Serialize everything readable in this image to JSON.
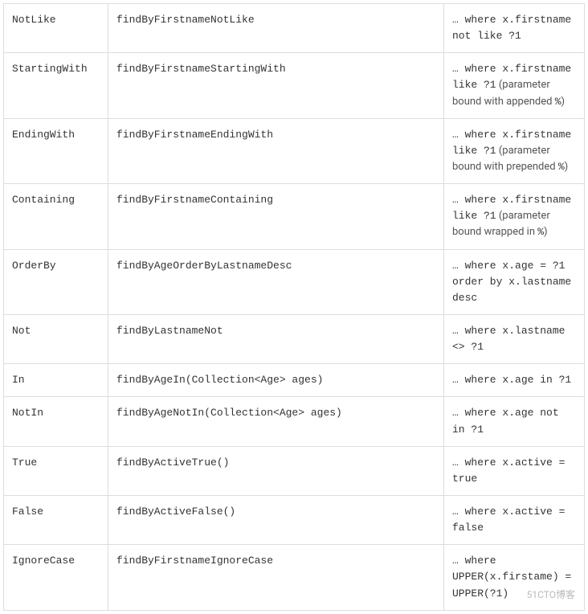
{
  "watermark": "51CTO博客",
  "table": {
    "rows": [
      {
        "keyword": "NotLike",
        "sample": "findByFirstnameNotLike",
        "result": [
          {
            "type": "code",
            "text": "… where x.firstname not like ?1"
          }
        ]
      },
      {
        "keyword": "StartingWith",
        "sample": "findByFirstnameStartingWith",
        "result": [
          {
            "type": "code",
            "text": "… where x.firstname like ?1"
          },
          {
            "type": "plain",
            "text": " (parameter bound with appended "
          },
          {
            "type": "code",
            "text": "%"
          },
          {
            "type": "plain",
            "text": ")"
          }
        ]
      },
      {
        "keyword": "EndingWith",
        "sample": "findByFirstnameEndingWith",
        "result": [
          {
            "type": "code",
            "text": "… where x.firstname like ?1"
          },
          {
            "type": "plain",
            "text": " (parameter bound with prepended "
          },
          {
            "type": "code",
            "text": "%"
          },
          {
            "type": "plain",
            "text": ")"
          }
        ]
      },
      {
        "keyword": "Containing",
        "sample": "findByFirstnameContaining",
        "result": [
          {
            "type": "code",
            "text": "… where x.firstname like ?1"
          },
          {
            "type": "plain",
            "text": " (parameter bound wrapped in "
          },
          {
            "type": "code",
            "text": "%"
          },
          {
            "type": "plain",
            "text": ")"
          }
        ]
      },
      {
        "keyword": "OrderBy",
        "sample": "findByAgeOrderByLastnameDesc",
        "result": [
          {
            "type": "code",
            "text": "… where x.age = ?1 order by x.lastname desc"
          }
        ]
      },
      {
        "keyword": "Not",
        "sample": "findByLastnameNot",
        "result": [
          {
            "type": "code",
            "text": "… where x.lastname <> ?1"
          }
        ]
      },
      {
        "keyword": "In",
        "sample": "findByAgeIn(Collection<Age> ages)",
        "result": [
          {
            "type": "code",
            "text": "… where x.age in ?1"
          }
        ]
      },
      {
        "keyword": "NotIn",
        "sample": "findByAgeNotIn(Collection<Age> ages)",
        "result": [
          {
            "type": "code",
            "text": "… where x.age not in ?1"
          }
        ]
      },
      {
        "keyword": "True",
        "sample": "findByActiveTrue()",
        "result": [
          {
            "type": "code",
            "text": "… where x.active = true"
          }
        ]
      },
      {
        "keyword": "False",
        "sample": "findByActiveFalse()",
        "result": [
          {
            "type": "code",
            "text": "… where x.active = false"
          }
        ]
      },
      {
        "keyword": "IgnoreCase",
        "sample": "findByFirstnameIgnoreCase",
        "result": [
          {
            "type": "code",
            "text": "… where UPPER(x.firstame) = UPPER(?1)"
          }
        ]
      }
    ]
  }
}
